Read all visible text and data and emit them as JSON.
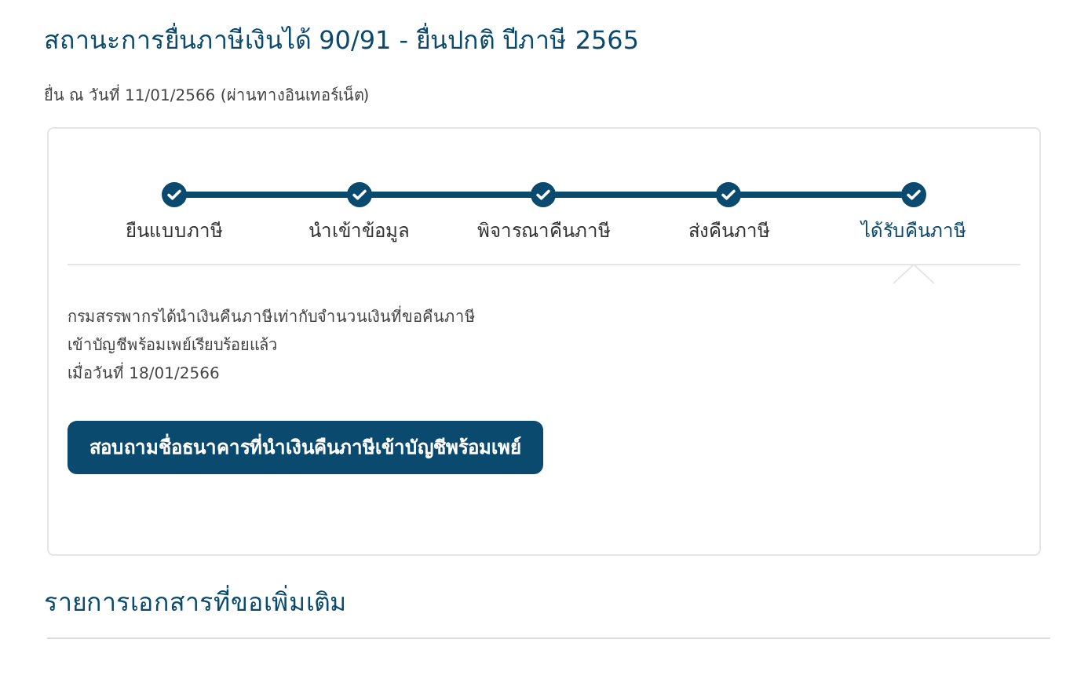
{
  "title": "สถานะการยื่นภาษีเงินได้ 90/91 - ยื่นปกติ ปีภาษี 2565",
  "subtitle": "ยื่น ณ วันที่ 11/01/2566 (ผ่านทางอินเทอร์เน็ต)",
  "steps": [
    {
      "label": "ยืนแบบภาษี",
      "completed": true,
      "selected": false
    },
    {
      "label": "นำเข้าข้อมูล",
      "completed": true,
      "selected": false
    },
    {
      "label": "พิจารณาคืนภาษี",
      "completed": true,
      "selected": false
    },
    {
      "label": "ส่งคืนภาษี",
      "completed": true,
      "selected": false
    },
    {
      "label": "ได้รับคืนภาษี",
      "completed": true,
      "selected": true
    }
  ],
  "detail_lines": [
    "กรมสรรพากรได้นำเงินคืนภาษีเท่ากับจำนวนเงินที่ขอคืนภาษี",
    "เข้าบัญชีพร้อมเพย์เรียบร้อยแล้ว",
    "เมื่อวันที่ 18/01/2566"
  ],
  "button": "สอบถามชื่อธนาคารที่นำเงินคืนภาษีเข้าบัญชีพร้อมเพย์",
  "section_title": "รายการเอกสารที่ขอเพิ่มเติม"
}
